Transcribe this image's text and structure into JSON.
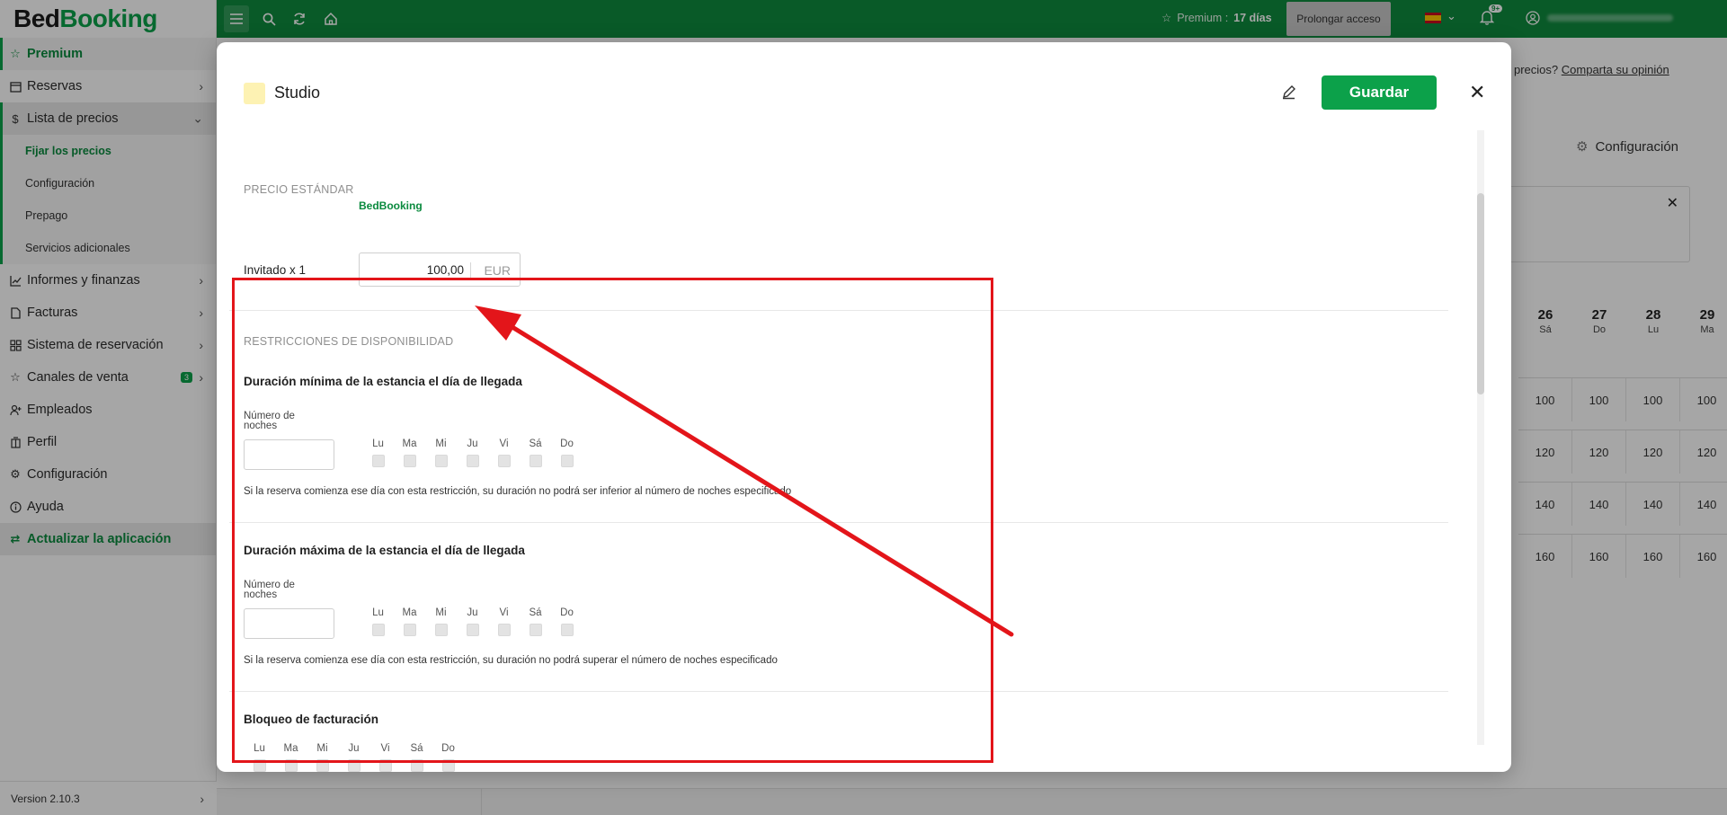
{
  "sidebar": {
    "logo_part1": "Bed",
    "logo_part2": "Booking",
    "premium": "Premium",
    "items": {
      "reservas": "Reservas",
      "lista_precios": "Lista de precios",
      "informes": "Informes y finanzas",
      "facturas": "Facturas",
      "sistema": "Sistema de reservación",
      "canales": "Canales de venta",
      "canales_badge": "3",
      "empleados": "Empleados",
      "perfil": "Perfil",
      "configuracion": "Configuración",
      "ayuda": "Ayuda",
      "actualizar": "Actualizar la aplicación"
    },
    "sub_items": {
      "fijar": "Fijar los precios",
      "configuracion": "Configuración",
      "prepago": "Prepago",
      "servicios": "Servicios adicionales"
    },
    "version": "Version 2.10.3"
  },
  "topbar": {
    "premium_label": "Premium :",
    "premium_days": "17 días",
    "prolong_button": "Prolongar acceso",
    "notifications_badge": "9+",
    "brand_color": "#0f8a3e"
  },
  "background": {
    "opinion_text": "precios?",
    "opinion_link": "Comparta su opinión",
    "config_label": "Configuración",
    "calendar": {
      "days": [
        {
          "d": "26",
          "w": "Sá"
        },
        {
          "d": "27",
          "w": "Do"
        },
        {
          "d": "28",
          "w": "Lu"
        },
        {
          "d": "29",
          "w": "Ma"
        }
      ],
      "rows": [
        [
          "100",
          "100",
          "100",
          "100"
        ],
        [
          "120",
          "120",
          "120",
          "120"
        ],
        [
          "140",
          "140",
          "140",
          "140"
        ],
        [
          "160",
          "160",
          "160",
          "160"
        ]
      ]
    }
  },
  "modal": {
    "title": "Studio",
    "swatch_color": "#fdf2b3",
    "save_button": "Guardar",
    "standard_price": {
      "section_label": "PRECIO ESTÁNDAR",
      "source_label": "BedBooking",
      "row_label": "Invitado x 1",
      "value": "100,00",
      "currency": "EUR"
    },
    "restrictions": {
      "section_label": "RESTRICCIONES DE DISPONIBILIDAD",
      "min_stay": {
        "title": "Duración mínima de la estancia el día de llegada",
        "nights_label": "Número de noches",
        "hint": "Si la reserva comienza ese día con esta restricción, su duración no podrá ser inferior al número de noches especificado"
      },
      "max_stay": {
        "title": "Duración máxima de la estancia el día de llegada",
        "nights_label": "Número de noches",
        "hint": "Si la reserva comienza ese día con esta restricción, su duración no podrá superar el número de noches especificado"
      },
      "billing_block": {
        "title": "Bloqueo de facturación"
      },
      "weekdays": [
        "Lu",
        "Ma",
        "Mi",
        "Ju",
        "Vi",
        "Sá",
        "Do"
      ]
    }
  },
  "annotation": {
    "color": "#e3151a"
  }
}
